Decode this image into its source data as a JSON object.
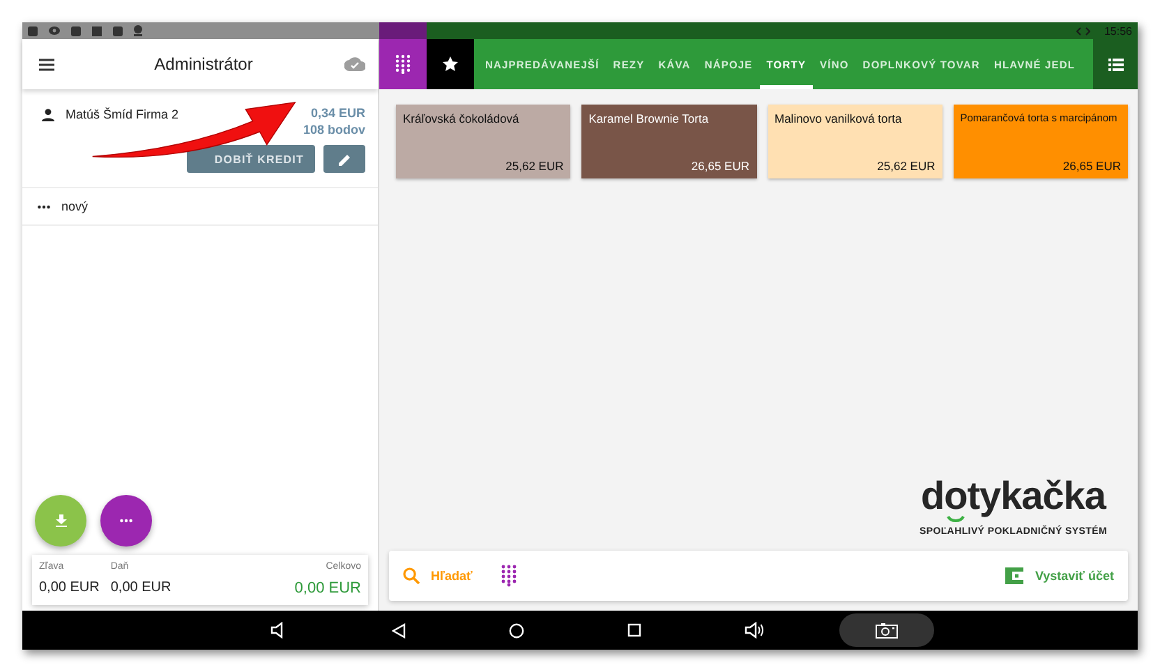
{
  "status_bar": {
    "time": "15:56"
  },
  "left_panel": {
    "title": "Administrátor",
    "customer": {
      "name": "Matúš Šmíd Firma 2",
      "balance": "0,34 EUR",
      "points": "108 bodov",
      "credit_button": "DOBIŤ KREDIT"
    },
    "new_row": {
      "label": "nový"
    },
    "totals": [
      {
        "label": "Zľava",
        "value": "0,00 EUR",
        "kind": "plain"
      },
      {
        "label": "Daň",
        "value": "0,00 EUR",
        "kind": "plain"
      },
      {
        "label": "Celkovo",
        "value": "0,00 EUR",
        "kind": "total"
      }
    ]
  },
  "tabs": [
    {
      "label": "NAJPREDÁVANEJŠÍ",
      "selected": false
    },
    {
      "label": "REZY",
      "selected": false
    },
    {
      "label": "KÁVA",
      "selected": false
    },
    {
      "label": "NÁPOJE",
      "selected": false
    },
    {
      "label": "TORTY",
      "selected": true
    },
    {
      "label": "VÍNO",
      "selected": false
    },
    {
      "label": "DOPLNKOVÝ TOVAR",
      "selected": false
    },
    {
      "label": "HLAVNÉ JEDL",
      "selected": false
    }
  ],
  "products": [
    {
      "name": "Kráľovská čokoládová",
      "price": "25,62 EUR",
      "color": "#bcaaa4"
    },
    {
      "name": "Karamel Brownie Torta",
      "price": "26,65 EUR",
      "color": "#795548"
    },
    {
      "name": "Malinovo vanilková torta",
      "price": "25,62 EUR",
      "color": "#ffe0b2"
    },
    {
      "name": "Pomarančová torta s marcipánom",
      "price": "26,65 EUR",
      "color": "#ff8f00"
    }
  ],
  "logo": {
    "name": "dotykačka",
    "tagline": "SPOĽAHLIVÝ POKLADNIČNÝ SYSTÉM"
  },
  "bottom_bar": {
    "search": "Hľadať",
    "invoice": "Vystaviť účet"
  }
}
